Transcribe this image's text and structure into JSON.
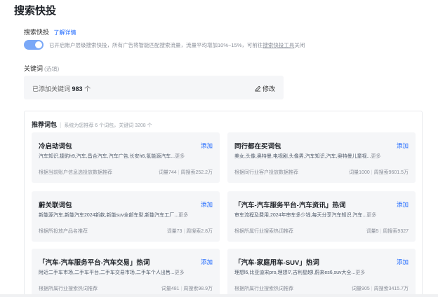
{
  "page": {
    "title": "搜索快投"
  },
  "quick_boost": {
    "label": "搜索快投",
    "learn_more": "了解详情",
    "enabled": true,
    "desc_prefix": "已开启账户层级搜索快投，所有广告将智能匹配搜索流量，流量平均增加10%~15%，可前往",
    "desc_link": "搜索快投工具",
    "desc_suffix": "关闭"
  },
  "keywords": {
    "label": "关键词",
    "hint": "(选填)",
    "added_prefix": "已添加关键词",
    "added_count": "983",
    "added_suffix": "个",
    "edit_label": "修改"
  },
  "recommend": {
    "title": "推荐词包",
    "subtitle": "系统为您推荐 6 个词包，关键词 3208 个",
    "cards": [
      {
        "title": "冷启动词包",
        "add": "添加",
        "words": "汽车知识,捷豹h9,汽车,昌合汽车,汽车广告,长安h6,氢能源汽车...",
        "more": "更多",
        "source": "根据当前账户信息选投放数据推荐",
        "volume": "词量744",
        "search": "周搜索252.2万"
      },
      {
        "title": "同行都在买词包",
        "add": "添加",
        "words": "美女,头像,奥特曼,电视剧,头像男,汽车知识,汽车,奥特曼儿童视...",
        "more": "更多",
        "source": "根据同行业客户投放数据推荐",
        "volume": "词量1000",
        "search": "周搜索9601.5万"
      },
      {
        "title": "蔚关联词包",
        "add": "添加",
        "words": "新能源汽车,新能汽车2024新款,新能suv全部车型,新能汽车工厂...",
        "more": "更多",
        "source": "根据所投放产品名推荐",
        "volume": "词量73",
        "search": "周搜索2.8万"
      },
      {
        "title": "「汽车-汽车服务平台-汽车资讯」热词",
        "add": "添加",
        "words": "审车流程及费用,2024年审车多少钱,每天分享汽车知识,汽车...",
        "more": "更多",
        "source": "根据所属行业搜索热词推荐",
        "volume": "词量5",
        "search": "周搜索9327"
      },
      {
        "title": "「汽车-汽车服务平台-汽车交易」热词",
        "add": "添加",
        "words": "附近二手车市场,二手车平台,二手车交易市场,二手车个人出售...",
        "more": "更多",
        "source": "根据所属行业搜索热词推荐",
        "volume": "词量481",
        "search": "周搜索98.9万"
      },
      {
        "title": "「汽车-家庭用车-SUV」热词",
        "add": "添加",
        "words": "理想l6,比亚迪宋pro,理想l7,吉利星越l,蔚来es6,suv大全...",
        "more": "更多",
        "source": "根据所属行业搜索热词推荐",
        "volume": "词量905",
        "search": "周搜索3415.7万"
      }
    ]
  },
  "colors": {
    "accent": "#1a66ff",
    "toggle_on": "#7aa8f7",
    "card_bg": "#f5f6f8"
  }
}
